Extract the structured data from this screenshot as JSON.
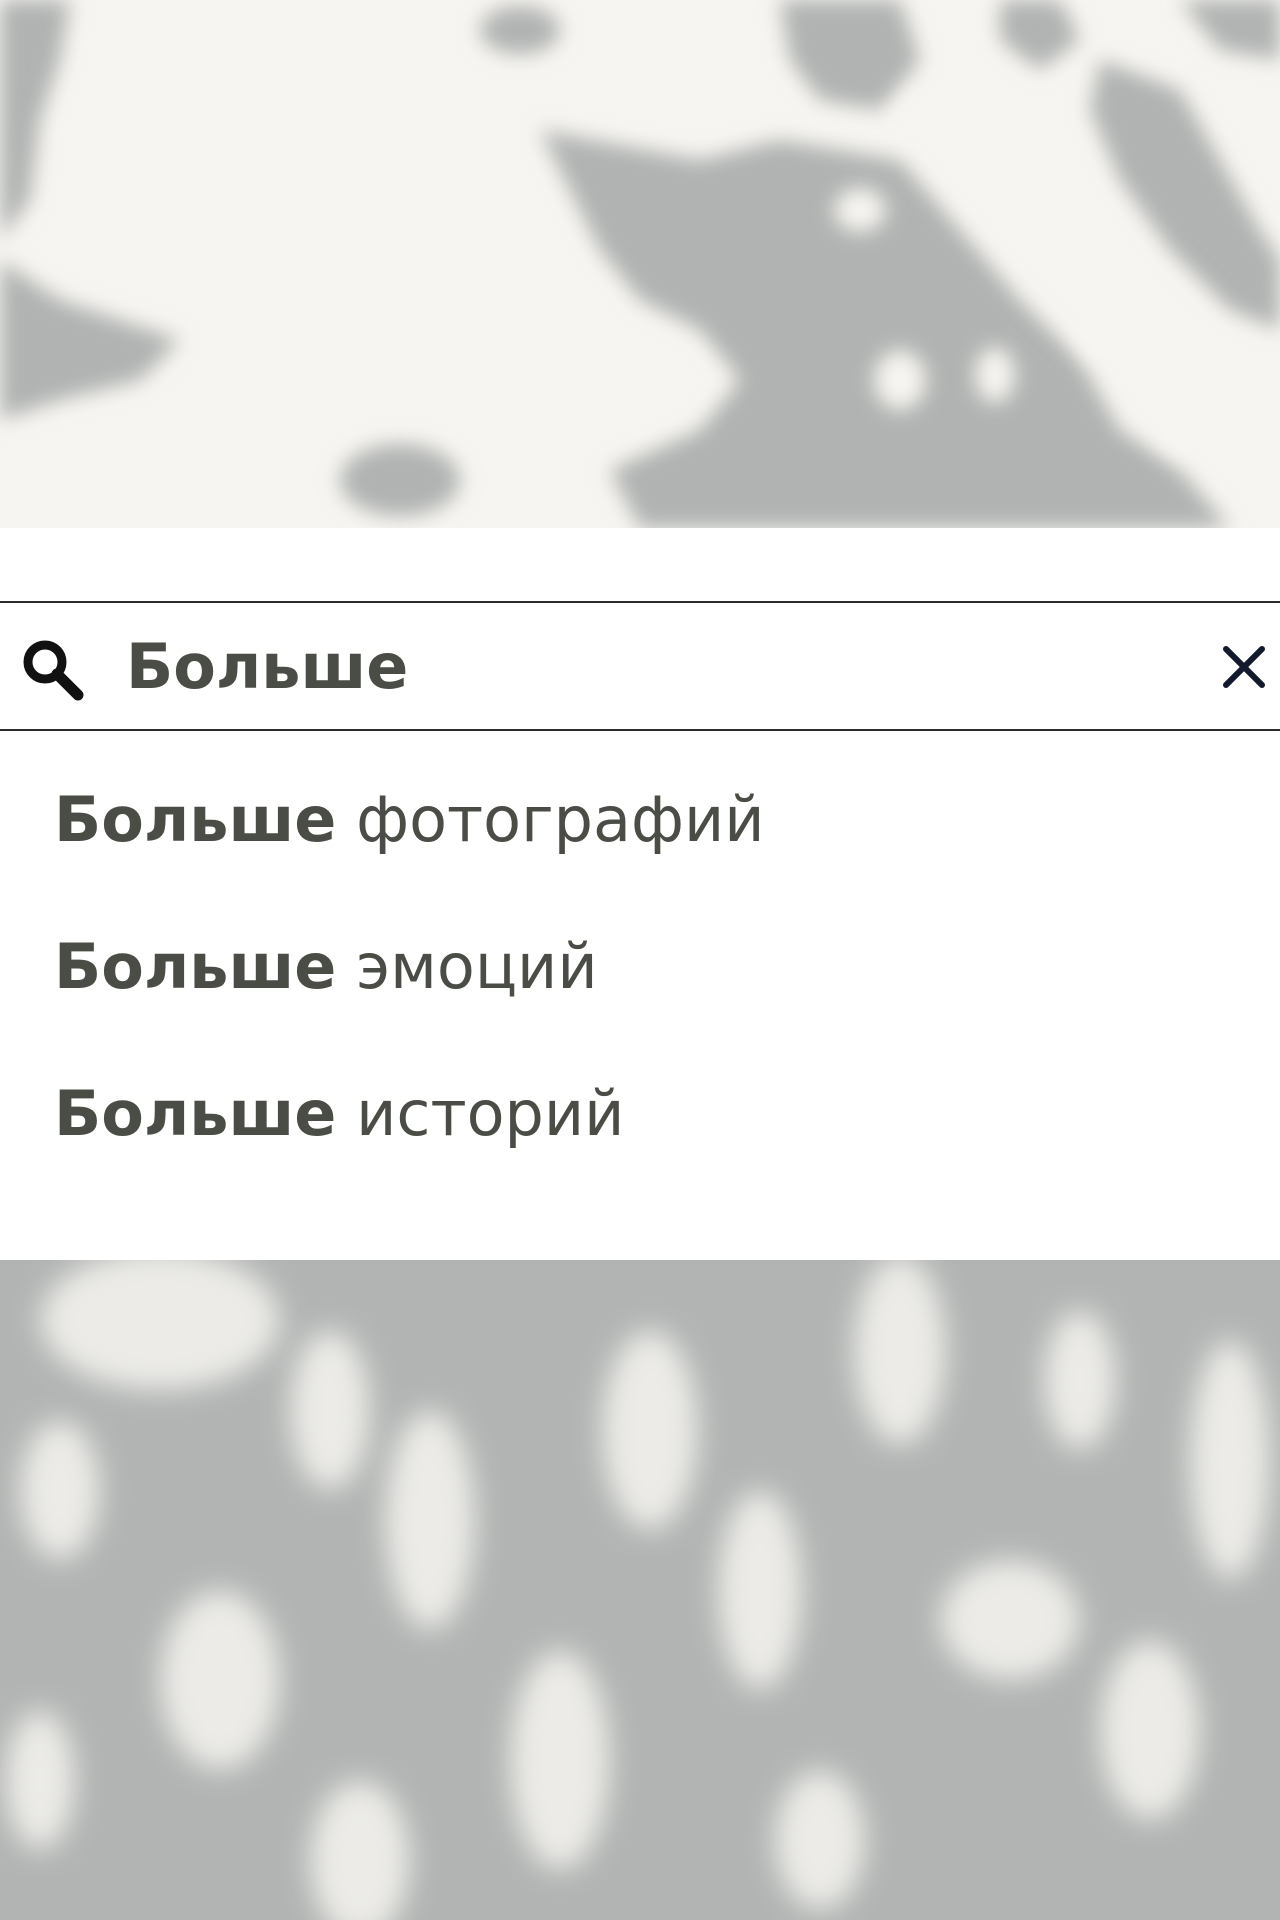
{
  "search": {
    "query": "Больше",
    "placeholder": ""
  },
  "suggestions": [
    {
      "match": "Больше",
      "rest": "фотографий"
    },
    {
      "match": "Больше",
      "rest": "эмоций"
    },
    {
      "match": "Больше",
      "rest": "историй"
    }
  ],
  "icons": {
    "search": "search-icon",
    "clear": "close-icon"
  },
  "colors": {
    "text": "#4a4d45",
    "border": "#2b2b2b",
    "panel": "#ffffff",
    "shadow_gray": "#b1b4b3",
    "light_patch": "#f6f4f0"
  }
}
